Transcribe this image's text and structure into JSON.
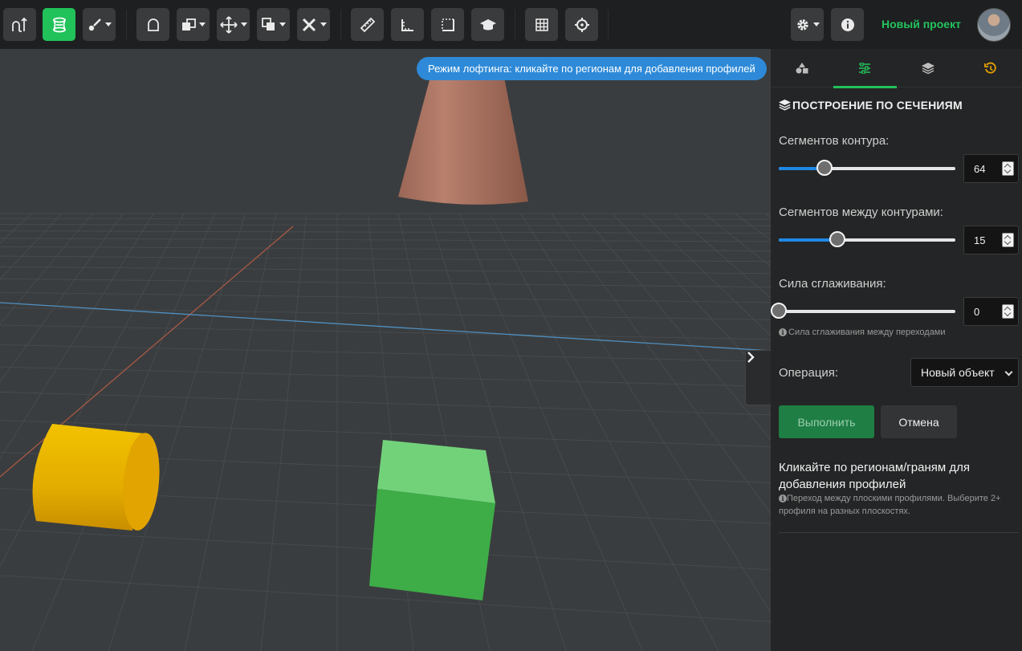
{
  "toolbar": {
    "buttons": [
      {
        "name": "sketch-tool",
        "icon": "sketch-arrow-icon"
      },
      {
        "name": "loft-tool",
        "icon": "loft-icon",
        "active": true
      },
      {
        "name": "draw-tool",
        "icon": "brush-icon",
        "dropdown": true
      },
      {
        "name": "shape-tool",
        "icon": "arch-icon"
      },
      {
        "name": "boolean-tool",
        "icon": "boolean-icon",
        "dropdown": true
      },
      {
        "name": "move-tool",
        "icon": "move-icon",
        "dropdown": true
      },
      {
        "name": "duplicate-tool",
        "icon": "copy-icon",
        "dropdown": true
      },
      {
        "name": "tools-menu",
        "icon": "wrench-icon",
        "dropdown": true
      },
      {
        "name": "measure-tool",
        "icon": "ruler-icon"
      },
      {
        "name": "angle-tool",
        "icon": "angle-ruler-icon"
      },
      {
        "name": "frame-tool",
        "icon": "frame-icon"
      },
      {
        "name": "tutorial",
        "icon": "graduation-cap-icon"
      },
      {
        "name": "grid-toggle",
        "icon": "grid-icon"
      },
      {
        "name": "snap-toggle",
        "icon": "crosshair-icon"
      },
      {
        "name": "settings",
        "icon": "gear-icon",
        "dropdown": true
      },
      {
        "name": "info",
        "icon": "info-icon"
      }
    ],
    "project_name": "Новый проект"
  },
  "viewport": {
    "hint": "Режим лофтинга: кликайте по регионам для добавления профилей"
  },
  "panel": {
    "tabs": [
      {
        "name": "shapes",
        "icon": "shapes-icon"
      },
      {
        "name": "properties",
        "icon": "sliders-icon",
        "active": true
      },
      {
        "name": "layers",
        "icon": "layers-icon"
      },
      {
        "name": "history",
        "icon": "history-icon"
      }
    ],
    "section_title": "ПОСТРОЕНИЕ ПО СЕЧЕНИЯМ",
    "contour_segments": {
      "label": "Сегментов контура:",
      "value": "64",
      "fraction": 0.26
    },
    "between_segments": {
      "label": "Сегментов между контурами:",
      "value": "15",
      "fraction": 0.33
    },
    "smoothing": {
      "label": "Сила сглаживания:",
      "value": "0",
      "fraction": 0.0,
      "help": "Сила сглаживания между переходами"
    },
    "operation": {
      "label": "Операция:",
      "selected": "Новый объект"
    },
    "execute_label": "Выполнить",
    "cancel_label": "Отмена",
    "instruction_title": "Кликайте по регионам/граням для добавления профилей",
    "instruction_note": "Переход между плоскими профилями. Выберите 2+ профиля на разных плоскостях.",
    "colors": {
      "accent": "#21c25a",
      "slider": "#1e88e5",
      "history": "#e6a000"
    }
  }
}
